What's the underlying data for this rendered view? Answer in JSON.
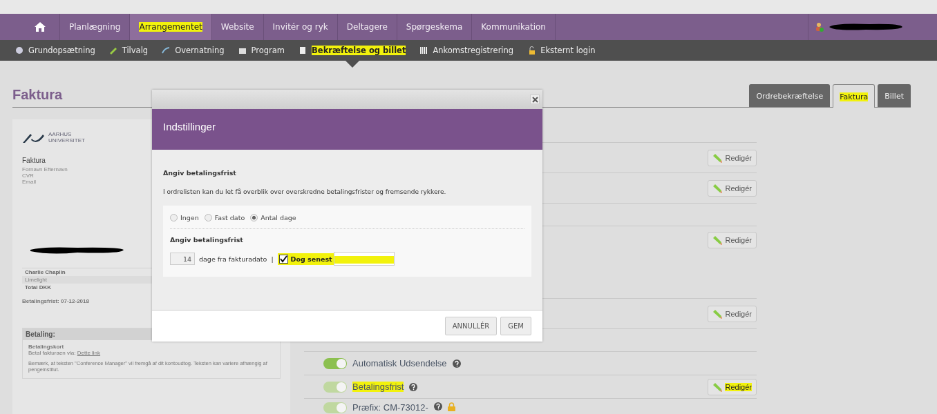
{
  "top_nav": {
    "items": [
      {
        "label": "Planlægning",
        "selected": false,
        "highlighted": false
      },
      {
        "label": "Arrangementet",
        "selected": true,
        "highlighted": true
      },
      {
        "label": "Website",
        "selected": false,
        "highlighted": false
      },
      {
        "label": "Invitér og ryk",
        "selected": false,
        "highlighted": false
      },
      {
        "label": "Deltagere",
        "selected": false,
        "highlighted": false
      },
      {
        "label": "Spørgeskema",
        "selected": false,
        "highlighted": false
      },
      {
        "label": "Kommunikation",
        "selected": false,
        "highlighted": false
      }
    ]
  },
  "sub_nav": {
    "items": [
      {
        "label": "Grundopsætning",
        "selected": false,
        "highlighted": false
      },
      {
        "label": "Tilvalg",
        "selected": false,
        "highlighted": false
      },
      {
        "label": "Overnatning",
        "selected": false,
        "highlighted": false
      },
      {
        "label": "Program",
        "selected": false,
        "highlighted": false
      },
      {
        "label": "Bekræftelse og billet",
        "selected": true,
        "highlighted": true
      },
      {
        "label": "Ankomstregistrering",
        "selected": false,
        "highlighted": false
      },
      {
        "label": "Eksternt login",
        "selected": false,
        "highlighted": false
      }
    ]
  },
  "page": {
    "title": "Faktura",
    "tabs": [
      {
        "label": "Ordrebekræftelse",
        "selected": false,
        "highlighted": false
      },
      {
        "label": "Faktura",
        "selected": true,
        "highlighted": true
      },
      {
        "label": "Billet",
        "selected": false,
        "highlighted": false
      }
    ]
  },
  "invoice_preview": {
    "logo_text": [
      "AARHUS",
      "UNIVERSITET"
    ],
    "title": "Faktura",
    "customer_fields": [
      "Fornavn Efternavn",
      "CVR",
      "Email"
    ],
    "lines": [
      {
        "text": "Charlie Chaplin",
        "kind": "name"
      },
      {
        "text": "Limelight",
        "kind": "item"
      },
      {
        "text": "Total DKK",
        "kind": "total"
      }
    ],
    "due_date": "Betalingsfrist: 07-12-2018",
    "payment": {
      "heading": "Betaling:",
      "method": "Betalingskort",
      "pay_text": "Betal fakturaen via:",
      "pay_link": "Dette link",
      "note": "Bemærk, at teksten \"Conference Manager\" vil fremgå af dit kontoudtog. Teksten kan variere afhængig af pengeinstitut."
    }
  },
  "settings_rows": [
    {
      "kind": "edit",
      "edit_label": "Redigér",
      "highlighted": false
    },
    {
      "kind": "edit",
      "edit_label": "Redigér",
      "highlighted": false
    },
    {
      "kind": "blank"
    },
    {
      "kind": "edit",
      "edit_label": "Redigér",
      "highlighted": false
    },
    {
      "kind": "edit",
      "edit_label": "Redigér",
      "highlighted": false
    },
    {
      "kind": "blank"
    },
    {
      "kind": "toggle",
      "label": "Automatisk Udsendelse",
      "on": true,
      "disabled": false,
      "help": true,
      "highlighted": false
    },
    {
      "kind": "toggle",
      "label": "Betalingsfrist",
      "on": true,
      "disabled": true,
      "help": true,
      "highlighted": true,
      "edit_label": "Redigér",
      "edit_highlighted": true
    },
    {
      "kind": "toggle",
      "label": "Præfix: CM-73012-",
      "on": true,
      "disabled": true,
      "help": true,
      "lock": true,
      "highlighted": false
    }
  ],
  "dialog": {
    "title": "Indstillinger",
    "section_title": "Angiv betalingsfrist",
    "description": "I ordrelisten kan du let få overblik over overskredne betalingsfrister og fremsende rykkere.",
    "options": [
      {
        "label": "Ingen",
        "selected": false
      },
      {
        "label": "Fast dato",
        "selected": false
      },
      {
        "label": "Antal dage",
        "selected": true
      }
    ],
    "sub_title": "Angiv betalingsfrist",
    "days_value": "14",
    "days_text": "dage fra fakturadato",
    "separator": "|",
    "latest": {
      "label": "Dog senest",
      "checked": true,
      "highlighted": true
    },
    "buttons": [
      {
        "label": "ANNULLÉR"
      },
      {
        "label": "GEM"
      }
    ]
  }
}
